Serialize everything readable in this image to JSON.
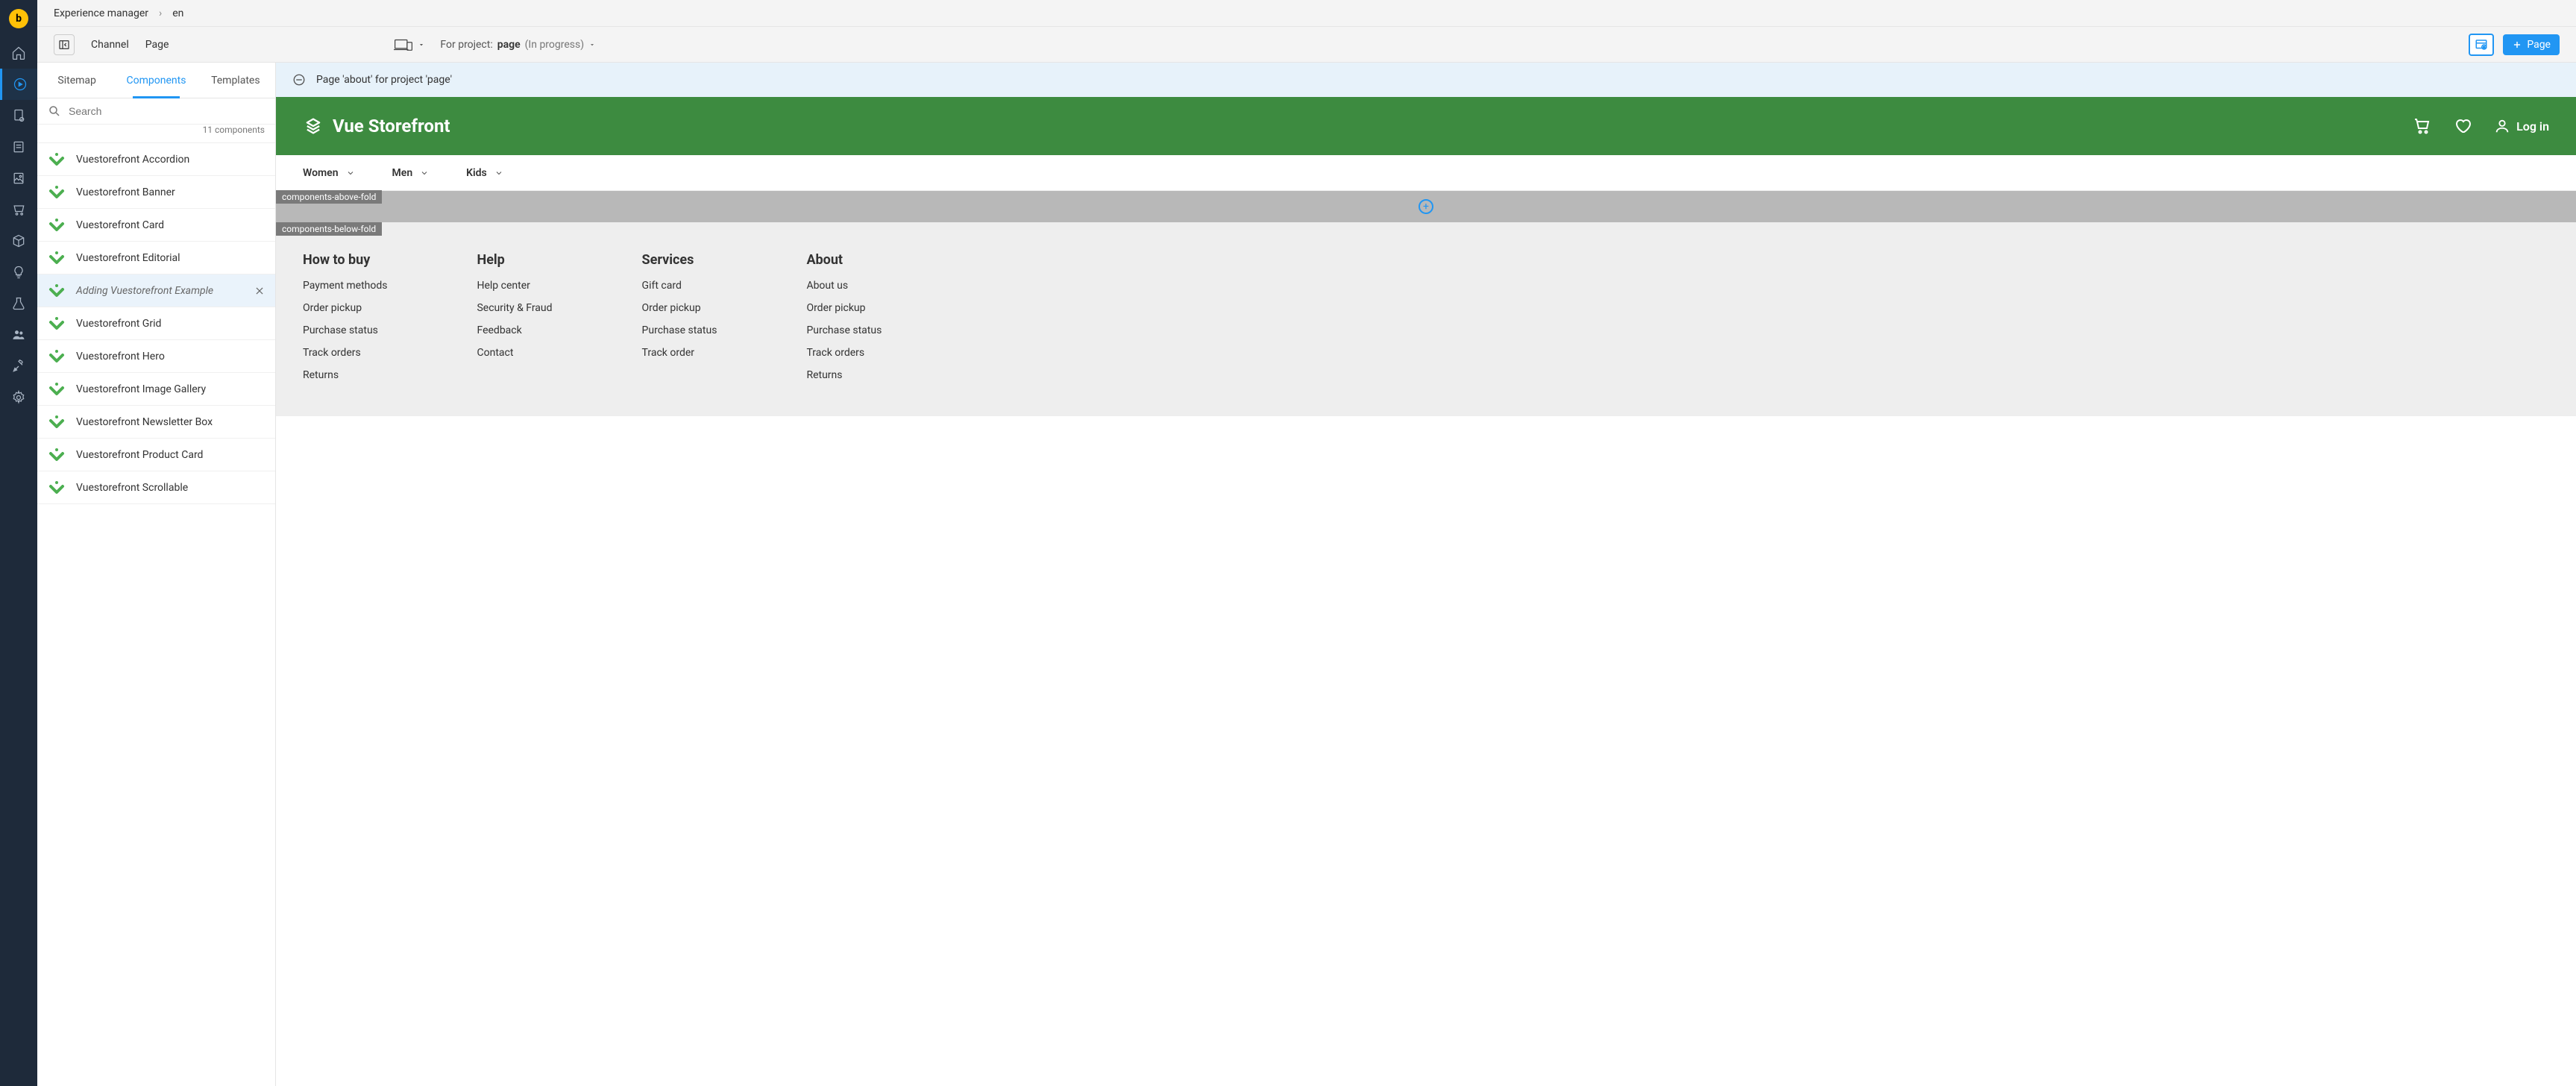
{
  "breadcrumb": {
    "root": "Experience manager",
    "leaf": "en"
  },
  "toolbar": {
    "channel": "Channel",
    "page": "Page",
    "for_project": "For project:",
    "project_name": "page",
    "project_status": "(In progress)",
    "add_page": "Page"
  },
  "tabs": {
    "sitemap": "Sitemap",
    "components": "Components",
    "templates": "Templates"
  },
  "search": {
    "placeholder": "Search",
    "count": "11 components"
  },
  "components": [
    {
      "label": "Vuestorefront Accordion"
    },
    {
      "label": "Vuestorefront Banner"
    },
    {
      "label": "Vuestorefront Card"
    },
    {
      "label": "Vuestorefront Editorial"
    },
    {
      "label": "Adding Vuestorefront Example",
      "dragging": true
    },
    {
      "label": "Vuestorefront Grid"
    },
    {
      "label": "Vuestorefront Hero"
    },
    {
      "label": "Vuestorefront Image Gallery"
    },
    {
      "label": "Vuestorefront Newsletter Box"
    },
    {
      "label": "Vuestorefront Product Card"
    },
    {
      "label": "Vuestorefront Scrollable"
    }
  ],
  "info_bar": "Page 'about' for project 'page'",
  "store": {
    "logo": "Vue Storefront",
    "login": "Log in",
    "categories": [
      "Women",
      "Men",
      "Kids"
    ]
  },
  "zones": {
    "above": "components-above-fold",
    "below": "components-below-fold"
  },
  "footer": [
    {
      "title": "How to buy",
      "links": [
        "Payment methods",
        "Order pickup",
        "Purchase status",
        "Track orders",
        "Returns"
      ]
    },
    {
      "title": "Help",
      "links": [
        "Help center",
        "Security & Fraud",
        "Feedback",
        "Contact"
      ]
    },
    {
      "title": "Services",
      "links": [
        "Gift card",
        "Order pickup",
        "Purchase status",
        "Track order"
      ]
    },
    {
      "title": "About",
      "links": [
        "About us",
        "Order pickup",
        "Purchase status",
        "Track orders",
        "Returns"
      ]
    }
  ]
}
